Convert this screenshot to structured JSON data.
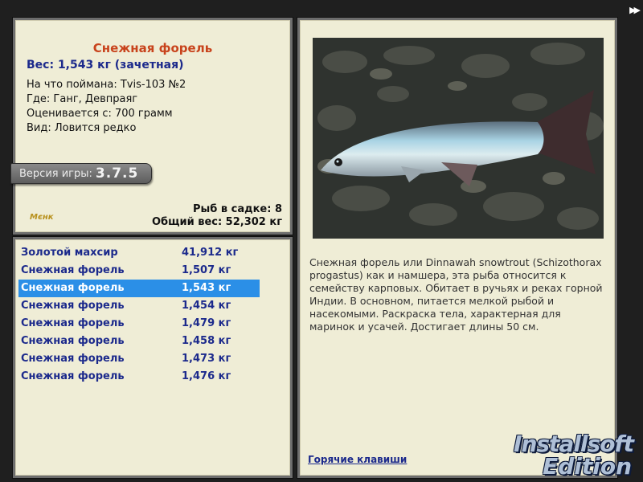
{
  "fish": {
    "title": "Снежная форель",
    "weight_line": "Вес: 1,543 кг (зачетная)",
    "info": [
      "На что поймана: Tvis-103 №2",
      "Где: Ганг, Девпраяг",
      "Оценивается с: 700 грамм",
      "Вид: Ловится редко"
    ]
  },
  "version": {
    "label": "Версия игры:",
    "value": "3.7.5"
  },
  "logo": {
    "text": "Мєнк"
  },
  "cage": {
    "count_line": "Рыб в садке: 8",
    "total_line": "Общий вес: 52,302 кг"
  },
  "catch_list": [
    {
      "name": "Золотой махсир",
      "weight": "41,912 кг",
      "selected": false
    },
    {
      "name": "Снежная форель",
      "weight": "1,507 кг",
      "selected": false
    },
    {
      "name": "Снежная форель",
      "weight": "1,543 кг",
      "selected": true
    },
    {
      "name": "Снежная форель",
      "weight": "1,454 кг",
      "selected": false
    },
    {
      "name": "Снежная форель",
      "weight": "1,479 кг",
      "selected": false
    },
    {
      "name": "Снежная форель",
      "weight": "1,458 кг",
      "selected": false
    },
    {
      "name": "Снежная форель",
      "weight": "1,473 кг",
      "selected": false
    },
    {
      "name": "Снежная форель",
      "weight": "1,476 кг",
      "selected": false
    }
  ],
  "description": "Снежная форель или Dinnawah snowtrout (Schizothorax progastus) как и намшера, эта рыба относится к семейству карповых. Обитает в ручьях и реках горной Индии. В основном, питается мелкой рыбой и насекомыми. Раскраска тела, характерная для маринок и усачей. Достигает длины 50 см.",
  "hotkeys_link": "Горячие клавиши",
  "nav": {
    "icon": "fast-forward-icon",
    "glyph": "▶▶"
  },
  "watermark": {
    "line1": "Installsoft",
    "line2": "Edition"
  },
  "colors": {
    "title": "#c8431c",
    "accent_blue": "#1c2a8c",
    "selection": "#2b8fe7",
    "panel_bg": "#efedd6"
  }
}
